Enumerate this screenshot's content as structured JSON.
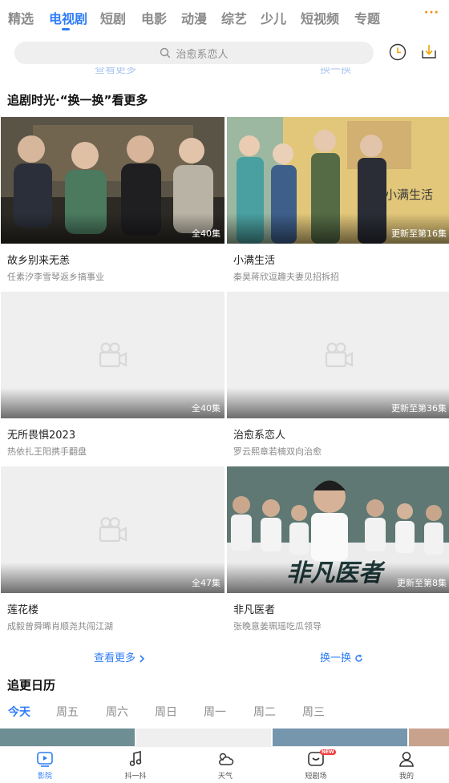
{
  "top_tabs": [
    {
      "label": "精选",
      "active": false
    },
    {
      "label": "电视剧",
      "active": true
    },
    {
      "label": "短剧",
      "active": false
    },
    {
      "label": "电影",
      "active": false
    },
    {
      "label": "动漫",
      "active": false
    },
    {
      "label": "综艺",
      "active": false
    },
    {
      "label": "少儿",
      "active": false
    },
    {
      "label": "短视频",
      "active": false
    },
    {
      "label": "专题",
      "active": false
    }
  ],
  "more_menu": "···",
  "search": {
    "placeholder": "治愈系恋人"
  },
  "clipped_links": {
    "left": "查看更多",
    "right": "换一换"
  },
  "section1": {
    "title": "追剧时光·“换一换”看更多",
    "cards": [
      {
        "title": "故乡别来无恙",
        "subtitle": "任素汐李雪琴返乡搞事业",
        "badge": "全40集",
        "image": "photo"
      },
      {
        "title": "小满生活",
        "subtitle": "秦昊蒋欣逗趣夫妻见招拆招",
        "badge": "更新至第16集",
        "image": "photo",
        "poster_text": "小满生活"
      },
      {
        "title": "无所畏惧2023",
        "subtitle": "热依扎王阳携手翻盘",
        "badge": "全40集",
        "image": "placeholder"
      },
      {
        "title": "治愈系恋人",
        "subtitle": "罗云熙章若楠双向治愈",
        "badge": "更新至第36集",
        "image": "placeholder"
      },
      {
        "title": "莲花楼",
        "subtitle": "成毅曾舜晞肖顺尧共闯江湖",
        "badge": "全47集",
        "image": "placeholder"
      },
      {
        "title": "非凡医者",
        "subtitle": "张晚意姜珮瑶吃瓜领导",
        "badge": "更新至第8集",
        "image": "photo",
        "poster_text": "非凡医者"
      }
    ],
    "see_more": "查看更多",
    "refresh": "换一换"
  },
  "section2": {
    "title": "追更日历",
    "days": [
      {
        "label": "今天",
        "active": true
      },
      {
        "label": "周五",
        "active": false
      },
      {
        "label": "周六",
        "active": false
      },
      {
        "label": "周日",
        "active": false
      },
      {
        "label": "周一",
        "active": false
      },
      {
        "label": "周二",
        "active": false
      },
      {
        "label": "周三",
        "active": false
      }
    ]
  },
  "bottom_nav": [
    {
      "label": "影院",
      "icon": "play-icon",
      "active": true
    },
    {
      "label": "抖一抖",
      "icon": "music-note-icon",
      "active": false
    },
    {
      "label": "天气",
      "icon": "weather-icon",
      "active": false
    },
    {
      "label": "短剧场",
      "icon": "shortplay-icon",
      "active": false,
      "badge": "NEW"
    },
    {
      "label": "我的",
      "icon": "profile-icon",
      "active": false
    }
  ],
  "colors": {
    "accent": "#2f7df6",
    "more": "#f08a00",
    "badge_red": "#f03a3a"
  }
}
